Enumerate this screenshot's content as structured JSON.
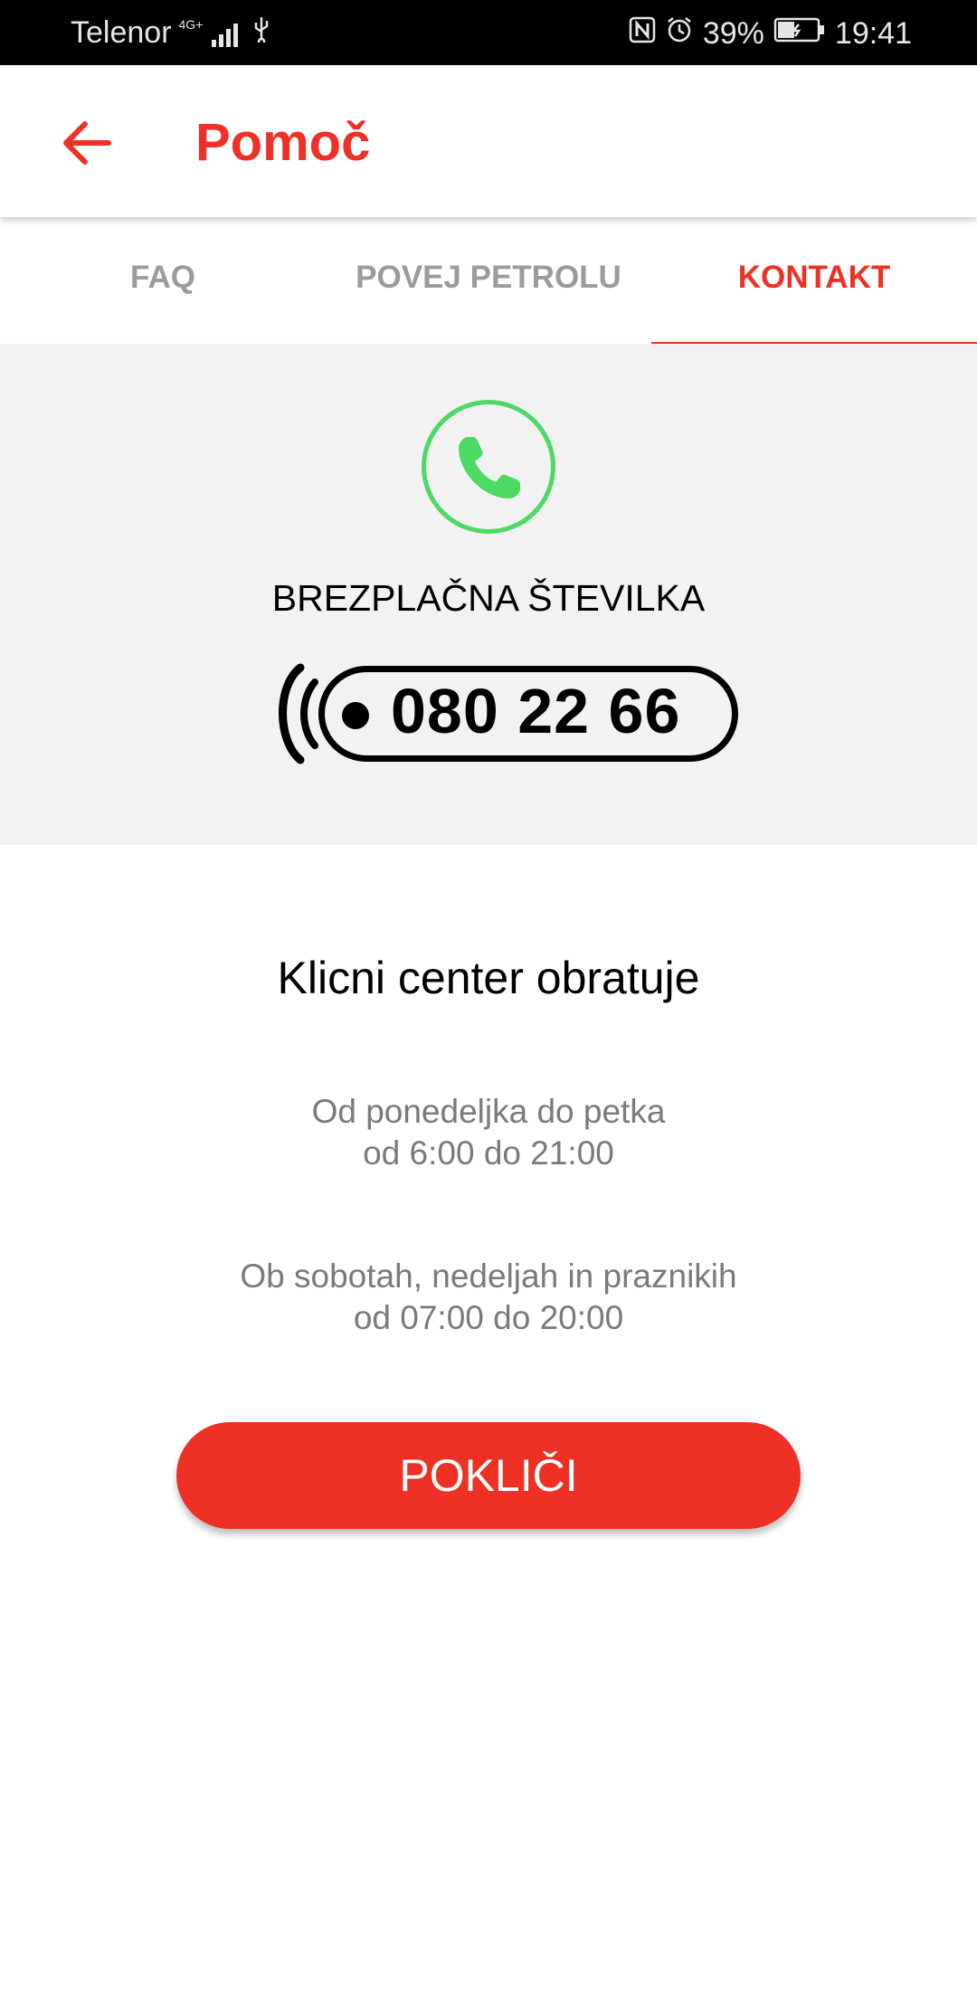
{
  "status_bar": {
    "carrier": "Telenor",
    "network": "4G+",
    "battery": "39%",
    "time": "19:41",
    "icons": [
      "signal-icon",
      "usb-icon",
      "nfc-icon",
      "alarm-icon",
      "battery-icon"
    ]
  },
  "app_bar": {
    "title": "Pomoč",
    "back_icon": "arrow-left-icon"
  },
  "tabs": [
    {
      "label": "FAQ",
      "active": false
    },
    {
      "label": "POVEJ PETROLU",
      "active": false
    },
    {
      "label": "KONTAKT",
      "active": true
    }
  ],
  "contact": {
    "phone_icon": "phone-icon",
    "free_label": "BREZPLAČNA ŠTEVILKA",
    "number": "080 22 66"
  },
  "hours": {
    "title": "Klicni center obratuje",
    "weekdays_line1": "Od ponedeljka do petka",
    "weekdays_line2": "od 6:00 do 21:00",
    "weekend_line1": "Ob sobotah, nedeljah in praznikih",
    "weekend_line2": "od 07:00 do 20:00"
  },
  "call_button": "POKLIČI",
  "colors": {
    "accent": "#ee3124",
    "phone_green": "#4cd964",
    "hero_bg": "#f2f2f2"
  }
}
